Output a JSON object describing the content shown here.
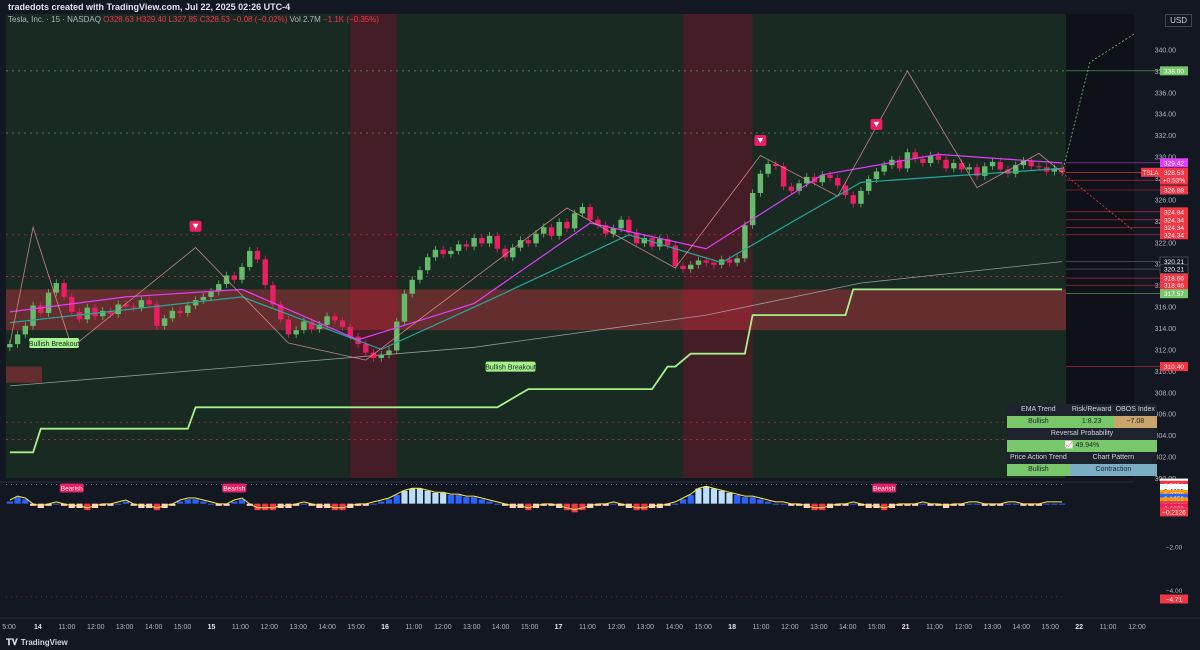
{
  "header": {
    "credit": "tradedots created with TradingView.com, Jul 22, 2025 02:26 UTC-4",
    "symbol": "Tesla, Inc. · 15 · NASDAQ",
    "o": "O328.63",
    "h": "H329.40",
    "l": "L327.85",
    "c": "C328.53",
    "chg": "−0.08 (−0.02%)",
    "vol": "Vol 2.7M",
    "vol_chg": "−1.1K (−0.35%)"
  },
  "currency": "USD",
  "brand": "TradingView",
  "colors": {
    "up": "#4caf50",
    "down": "#f23645",
    "ema_fast": "#e040fb",
    "ema_slow": "#26a69a",
    "trail": "#a5f28b",
    "bg_green": "#1f3a24",
    "bg_red": "#4a1c28"
  },
  "chart_data": [
    {
      "type": "candlestick",
      "title": "Tesla, Inc. · 15 · NASDAQ",
      "ylim": [
        300,
        342
      ],
      "y_ticks": [
        "340.00",
        "338.00",
        "336.00",
        "334.00",
        "332.00",
        "330.00",
        "328.00",
        "326.00",
        "324.00",
        "322.00",
        "320.00",
        "318.00",
        "316.00",
        "314.00",
        "312.00",
        "310.00",
        "308.00",
        "306.00",
        "304.00",
        "302.00",
        "300.00"
      ],
      "x_ticks": [
        "5:00",
        "14",
        "11:00",
        "12:00",
        "13:00",
        "14:00",
        "15:00",
        "15",
        "11:00",
        "12:00",
        "13:00",
        "14:00",
        "15:00",
        "16",
        "11:00",
        "12:00",
        "13:00",
        "14:00",
        "15:00",
        "17",
        "11:00",
        "12:00",
        "13:00",
        "14:00",
        "15:00",
        "18",
        "11:00",
        "12:00",
        "13:00",
        "14:00",
        "15:00",
        "21",
        "11:00",
        "12:00",
        "13:00",
        "14:00",
        "15:00",
        "22",
        "11:00",
        "12:00"
      ],
      "price_badges": [
        {
          "label": "338.00",
          "value": 338.0,
          "color": "#78c86b"
        },
        {
          "label": "329.42",
          "value": 329.42,
          "color": "#e040fb"
        },
        {
          "label": "TSLA",
          "value": 328.53,
          "color": "#f23645"
        },
        {
          "label": "328.53",
          "value": 328.53,
          "color": "#f23645"
        },
        {
          "label": "+0.53%",
          "value": 327.8,
          "color": "#f23645"
        },
        {
          "label": "326.88",
          "value": 326.88,
          "color": "#f23645"
        },
        {
          "label": "324.84",
          "value": 324.84,
          "color": "#f23645"
        },
        {
          "label": "324.34",
          "value": 324.1,
          "color": "#f23645"
        },
        {
          "label": "324.34",
          "value": 323.4,
          "color": "#f23645"
        },
        {
          "label": "324.34",
          "value": 322.7,
          "color": "#f23645"
        },
        {
          "label": "320.21",
          "value": 320.21,
          "color": "#131722"
        },
        {
          "label": "320.21",
          "value": 319.5,
          "color": "#131722"
        },
        {
          "label": "318.66",
          "value": 318.66,
          "color": "#f23645"
        },
        {
          "label": "318.46",
          "value": 318.0,
          "color": "#f23645"
        },
        {
          "label": "317.57",
          "value": 317.2,
          "color": "#78c86b"
        },
        {
          "label": "310.40",
          "value": 310.4,
          "color": "#f23645"
        }
      ],
      "signals": [
        {
          "label": "Bullish Breakout",
          "x": 3,
          "price": 312.6
        },
        {
          "label": "Bullish Breakout",
          "x": 62,
          "price": 310.4
        }
      ],
      "close": [
        312.5,
        313.4,
        314.2,
        316.1,
        315.4,
        317.3,
        318.2,
        316.9,
        315.5,
        314.8,
        315.9,
        315.1,
        315.6,
        315.3,
        316.2,
        316.0,
        315.9,
        316.6,
        316.2,
        314.2,
        314.9,
        315.6,
        315.4,
        316.1,
        316.6,
        316.9,
        317.4,
        318.1,
        318.9,
        318.5,
        319.7,
        321.2,
        320.4,
        318.0,
        316.2,
        314.8,
        313.4,
        313.8,
        314.6,
        313.9,
        314.3,
        315.1,
        314.7,
        314.1,
        313.2,
        312.5,
        311.7,
        311.2,
        311.5,
        311.9,
        314.6,
        317.2,
        318.5,
        319.4,
        320.6,
        321.3,
        320.9,
        321.2,
        321.8,
        321.6,
        322.4,
        321.9,
        322.6,
        321.4,
        320.6,
        321.5,
        322.2,
        321.9,
        322.8,
        323.4,
        322.6,
        323.9,
        323.3,
        324.7,
        325.3,
        324.1,
        323.6,
        322.8,
        323.3,
        324.1,
        322.9,
        321.9,
        322.4,
        321.6,
        322.3,
        321.7,
        319.8,
        319.5,
        319.9,
        320.3,
        320.1,
        319.9,
        320.4,
        320.1,
        320.5,
        323.6,
        326.6,
        328.4,
        329.3,
        329.1,
        327.2,
        326.8,
        327.5,
        328.1,
        327.6,
        328.3,
        328.0,
        327.3,
        326.4,
        325.6,
        326.8,
        327.9,
        328.6,
        329.2,
        329.7,
        328.9,
        330.4,
        329.8,
        329.4,
        330.1,
        329.7,
        328.9,
        329.4,
        328.8,
        329.0,
        328.2,
        329.1,
        329.5,
        328.8,
        328.4,
        329.2,
        329.6,
        329.1,
        329.0,
        328.6,
        328.9,
        328.53
      ],
      "ema_fast_pts": [
        [
          0,
          315.5
        ],
        [
          15,
          316.9
        ],
        [
          30,
          317.6
        ],
        [
          45,
          312.9
        ],
        [
          60,
          316.3
        ],
        [
          75,
          323.8
        ],
        [
          90,
          321.4
        ],
        [
          105,
          328.3
        ],
        [
          120,
          330.2
        ],
        [
          136,
          329.4
        ]
      ],
      "ema_slow_pts": [
        [
          0,
          314.5
        ],
        [
          30,
          316.9
        ],
        [
          48,
          312.0
        ],
        [
          62,
          316.6
        ],
        [
          80,
          322.7
        ],
        [
          92,
          320.1
        ],
        [
          110,
          327.6
        ],
        [
          136,
          328.9
        ]
      ],
      "trail_pts": [
        [
          0,
          302.4
        ],
        [
          3,
          302.4
        ],
        [
          4,
          304.6
        ],
        [
          23,
          304.6
        ],
        [
          24,
          306.6
        ],
        [
          63,
          306.6
        ],
        [
          67,
          308.3
        ],
        [
          83,
          308.3
        ],
        [
          85,
          310.4
        ],
        [
          86,
          310.4
        ],
        [
          88,
          311.6
        ],
        [
          95,
          311.6
        ],
        [
          96,
          315.2
        ],
        [
          108,
          315.2
        ],
        [
          109,
          317.6
        ],
        [
          136,
          317.6
        ]
      ],
      "sma_pts": [
        [
          0,
          308.6
        ],
        [
          30,
          310.4
        ],
        [
          60,
          312.2
        ],
        [
          90,
          315.2
        ],
        [
          110,
          318.2
        ],
        [
          136,
          320.2
        ]
      ]
    },
    {
      "type": "bar",
      "title": "",
      "ylim": [
        -5,
        1
      ],
      "y_ticks": [
        "0.7881",
        "0.7981",
        "0.4865",
        "0.4865",
        "0.3776",
        "0.1650",
        "0.0000",
        "0.0000",
        "0.0000",
        "−0.2126",
        "−2.00",
        "−4.00",
        "−4.71"
      ],
      "labels": [
        {
          "label": "Bearish",
          "x": 8
        },
        {
          "label": "Bearish",
          "x": 29
        },
        {
          "label": "Bearish",
          "x": 113
        }
      ],
      "values": [
        0.1,
        0.3,
        0.2,
        -0.1,
        -0.2,
        -0.1,
        0.0,
        -0.1,
        -0.2,
        -0.2,
        -0.3,
        -0.2,
        -0.1,
        -0.1,
        0.0,
        0.1,
        -0.1,
        -0.2,
        -0.2,
        -0.3,
        -0.2,
        -0.1,
        0.1,
        0.2,
        0.2,
        0.1,
        0.0,
        -0.1,
        -0.1,
        0.1,
        0.2,
        -0.1,
        -0.3,
        -0.3,
        -0.3,
        -0.2,
        -0.2,
        -0.1,
        0.0,
        -0.1,
        -0.2,
        -0.2,
        -0.3,
        -0.3,
        -0.2,
        -0.1,
        -0.1,
        0.0,
        0.1,
        0.2,
        0.4,
        0.6,
        0.7,
        0.7,
        0.6,
        0.5,
        0.5,
        0.4,
        0.4,
        0.3,
        0.3,
        0.2,
        0.1,
        0.0,
        -0.1,
        -0.2,
        -0.2,
        -0.3,
        -0.2,
        -0.1,
        -0.1,
        -0.2,
        -0.3,
        -0.4,
        -0.3,
        -0.2,
        -0.1,
        -0.1,
        0.0,
        -0.1,
        -0.2,
        -0.3,
        -0.3,
        -0.2,
        -0.2,
        -0.1,
        0.0,
        0.2,
        0.4,
        0.7,
        0.8,
        0.7,
        0.6,
        0.5,
        0.4,
        0.3,
        0.3,
        0.2,
        0.1,
        0.0,
        0.0,
        -0.1,
        -0.1,
        -0.2,
        -0.3,
        -0.3,
        -0.2,
        -0.1,
        -0.1,
        0.0,
        -0.1,
        -0.2,
        -0.2,
        -0.3,
        -0.2,
        -0.1,
        -0.1,
        -0.1,
        0.0,
        -0.1,
        -0.1,
        -0.2,
        -0.1,
        -0.1,
        0.0,
        0.0,
        -0.1,
        -0.1,
        -0.1,
        0.0,
        0.0,
        -0.1,
        -0.1,
        -0.1,
        0.0,
        0.0,
        0.0
      ]
    }
  ],
  "info_table": {
    "h1": "EMA Trend",
    "h2": "Risk/Reward",
    "h3": "OBOS Index",
    "v1": "Bullish",
    "v2": "1:8.23",
    "v3": "−7.08",
    "h4": "Reversal Probability",
    "v4": "📈 49.94%",
    "h5": "Price Action Trend",
    "h6": "Chart Pattern",
    "v5": "Bullish",
    "v6": "Contraction"
  }
}
